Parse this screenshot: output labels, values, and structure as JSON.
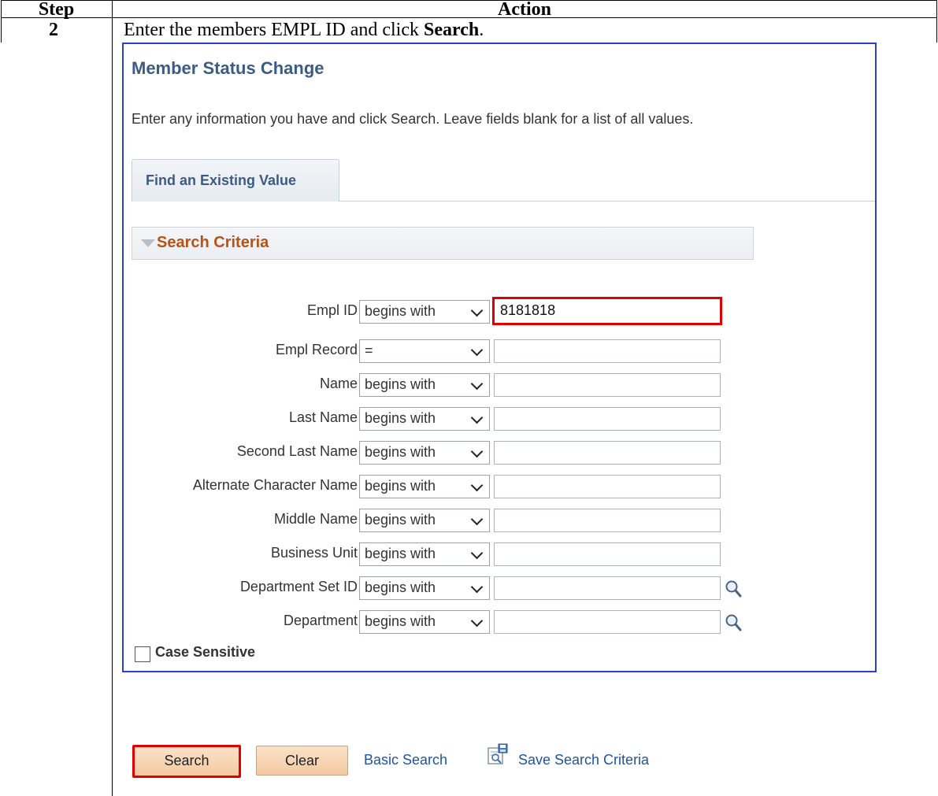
{
  "table": {
    "col_step": "Step",
    "col_action": "Action",
    "step_number": "2",
    "instruction_prefix": "Enter the members EMPL ID and click ",
    "instruction_bold": "Search",
    "instruction_suffix": "."
  },
  "app": {
    "title": "Member Status Change",
    "instructions": "Enter any information you have and click Search. Leave fields blank for a list of all values.",
    "tab_label": "Find an Existing Value",
    "criteria_header": "Search Criteria",
    "fields": [
      {
        "label": "Empl ID",
        "operator": "begins with",
        "value": "8181818",
        "lookup": false
      },
      {
        "label": "Empl Record",
        "operator": "=",
        "value": "",
        "lookup": false
      },
      {
        "label": "Name",
        "operator": "begins with",
        "value": "",
        "lookup": false
      },
      {
        "label": "Last Name",
        "operator": "begins with",
        "value": "",
        "lookup": false
      },
      {
        "label": "Second Last Name",
        "operator": "begins with",
        "value": "",
        "lookup": false
      },
      {
        "label": "Alternate Character Name",
        "operator": "begins with",
        "value": "",
        "lookup": false
      },
      {
        "label": "Middle Name",
        "operator": "begins with",
        "value": "",
        "lookup": false
      },
      {
        "label": "Business Unit",
        "operator": "begins with",
        "value": "",
        "lookup": false
      },
      {
        "label": "Department Set ID",
        "operator": "begins with",
        "value": "",
        "lookup": true
      },
      {
        "label": "Department",
        "operator": "begins with",
        "value": "",
        "lookup": true
      }
    ],
    "case_sensitive_label": "Case Sensitive",
    "case_sensitive_checked": false,
    "buttons": {
      "search": "Search",
      "clear": "Clear",
      "basic_search": "Basic Search",
      "save_search": "Save Search Criteria"
    },
    "colors": {
      "title": "#3c5b84",
      "criteria": "#b4531a",
      "link": "#1f54a3",
      "highlight": "#e00000",
      "button": "#f3c9a1"
    }
  }
}
